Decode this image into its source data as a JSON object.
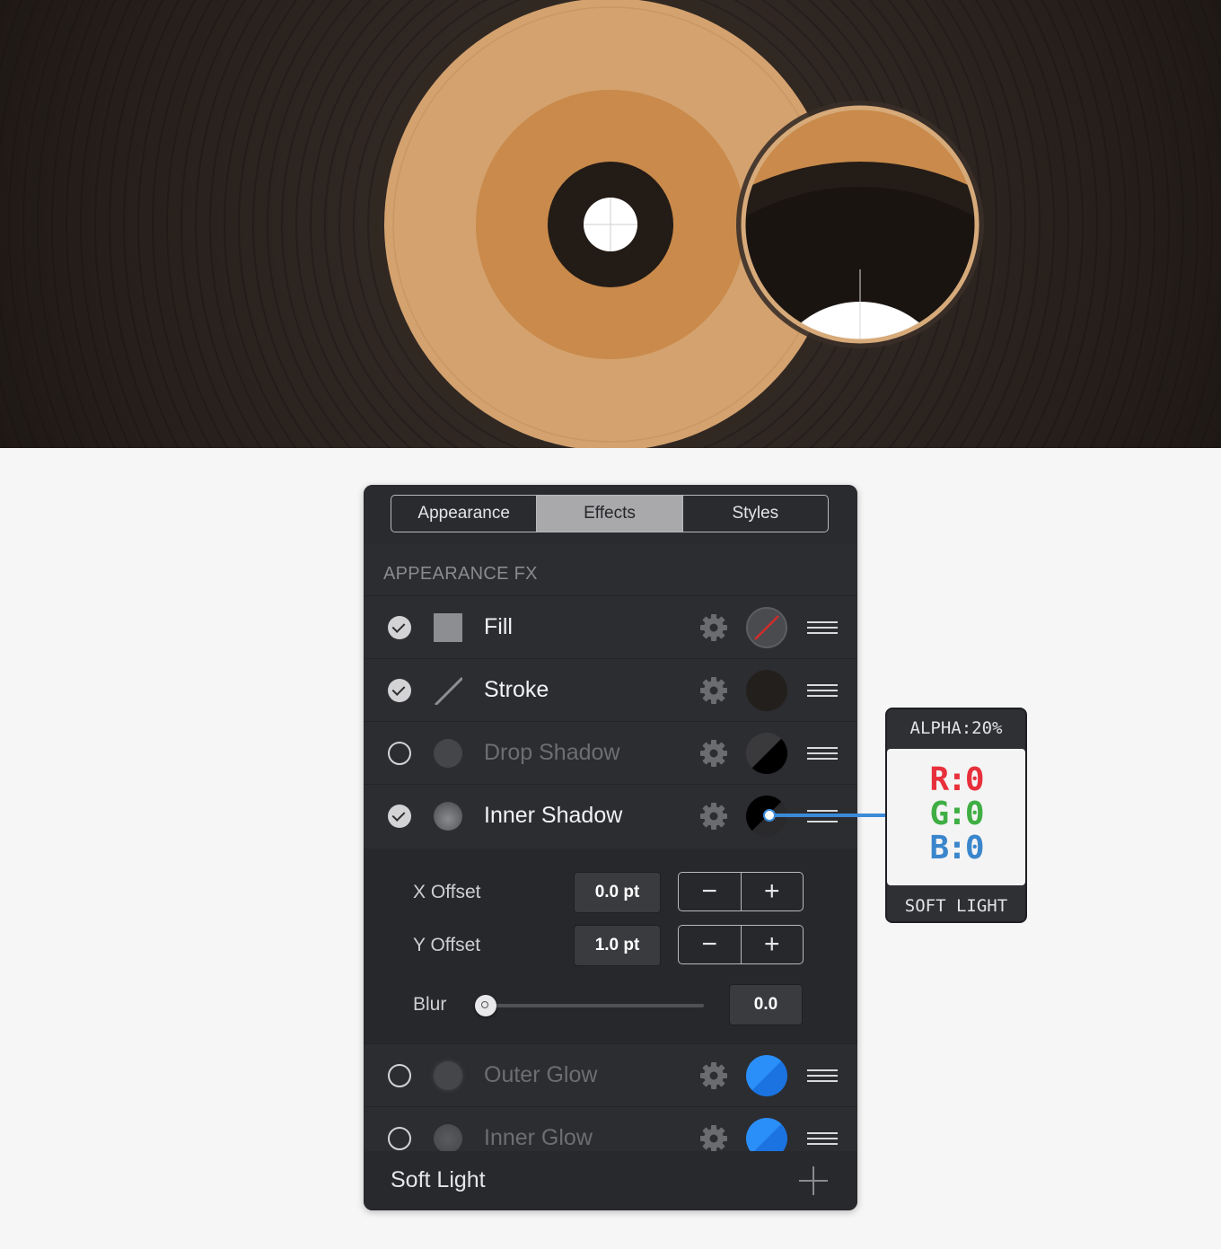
{
  "panel": {
    "tabs": [
      {
        "label": "Appearance",
        "active": false
      },
      {
        "label": "Effects",
        "active": true
      },
      {
        "label": "Styles",
        "active": false
      }
    ],
    "section_title": "APPEARANCE FX",
    "rows": [
      {
        "label": "Fill",
        "enabled": true,
        "icon": "square-icon",
        "swatch": "none-red-slash"
      },
      {
        "label": "Stroke",
        "enabled": true,
        "icon": "line-icon",
        "swatch": "#231f1c"
      },
      {
        "label": "Drop Shadow",
        "enabled": false,
        "icon": "circle-icon",
        "swatch": "#000000"
      },
      {
        "label": "Inner Shadow",
        "enabled": true,
        "icon": "circle-icon",
        "swatch": "#000000"
      },
      {
        "label": "Outer Glow",
        "enabled": false,
        "icon": "circle-icon",
        "swatch": "#1a82f7"
      },
      {
        "label": "Inner Glow",
        "enabled": false,
        "icon": "circle-icon",
        "swatch": "#1a82f7"
      }
    ],
    "inner_shadow": {
      "x_offset_label": "X Offset",
      "x_offset_value": "0.0 pt",
      "y_offset_label": "Y Offset",
      "y_offset_value": "1.0 pt",
      "blur_label": "Blur",
      "blur_value": "0.0",
      "minus": "−",
      "plus": "+"
    },
    "footer": {
      "blend_mode": "Soft Light",
      "add_icon": "plus-icon"
    }
  },
  "callout": {
    "alpha": "ALPHA:20%",
    "r": "R:0",
    "g": "G:0",
    "b": "B:0",
    "blend": "SOFT LIGHT"
  },
  "colors": {
    "background_dark": "#2a2420",
    "disc_outer": "#d4a26f",
    "disc_inner": "#c98a4b",
    "center_dark": "#231b16",
    "accent_blue": "#1a82f7"
  }
}
